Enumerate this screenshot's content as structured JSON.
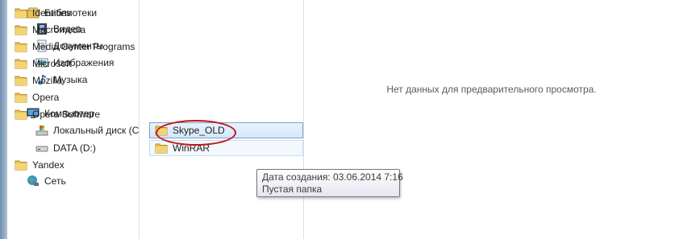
{
  "navigation": {
    "libraries": [
      {
        "label": "Библиотеки",
        "icon": "library-icon"
      },
      {
        "label": "Видео",
        "icon": "video-library-icon"
      },
      {
        "label": "Документы",
        "icon": "documents-library-icon"
      },
      {
        "label": "Изображения",
        "icon": "pictures-library-icon"
      },
      {
        "label": "Музыка",
        "icon": "music-library-icon"
      }
    ],
    "computer": [
      {
        "label": "Компьютер",
        "icon": "computer-icon"
      },
      {
        "label": "Локальный диск (C",
        "icon": "local-disk-icon"
      },
      {
        "label": "DATA (D:)",
        "icon": "drive-icon"
      }
    ],
    "network": {
      "label": "Сеть",
      "icon": "network-icon"
    }
  },
  "files": [
    {
      "name": "Identities"
    },
    {
      "name": "Macromedia"
    },
    {
      "name": "Media Center Programs"
    },
    {
      "name": "Microsoft"
    },
    {
      "name": "Mozilla"
    },
    {
      "name": "Opera"
    },
    {
      "name": "Opera Software"
    },
    {
      "name": "Skype_OLD"
    },
    {
      "name": "WinRAR"
    },
    {
      "name": "Yandex"
    }
  ],
  "preview": {
    "message": "Нет данных для предварительного просмотра."
  },
  "tooltip": {
    "created": "Дата создания: 03.06.2014 7:16",
    "status": "Пустая папка"
  },
  "colors": {
    "highlight_border": "#7da2ce",
    "annotation": "#c0151b",
    "folder": "#e8c25a"
  }
}
